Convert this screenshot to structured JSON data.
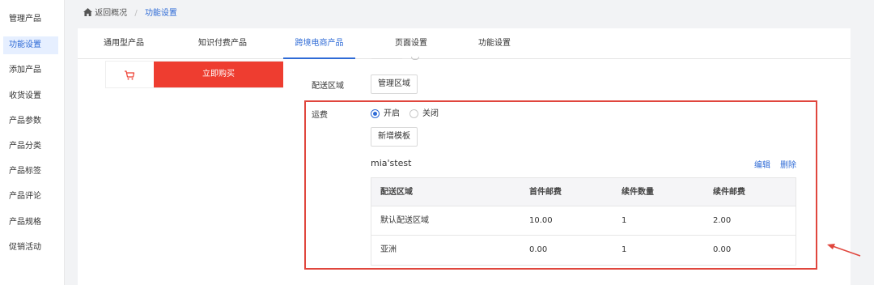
{
  "sidebar": {
    "items": [
      {
        "label": "管理产品"
      },
      {
        "label": "功能设置"
      },
      {
        "label": "添加产品"
      },
      {
        "label": "收货设置"
      },
      {
        "label": "产品参数"
      },
      {
        "label": "产品分类"
      },
      {
        "label": "产品标签"
      },
      {
        "label": "产品评论"
      },
      {
        "label": "产品规格"
      },
      {
        "label": "促销活动"
      }
    ],
    "active_index": 1
  },
  "breadcrumb": {
    "icon": "home-icon",
    "back": "返回概况",
    "separator": "/",
    "current": "功能设置"
  },
  "tabs": [
    {
      "label": "通用型产品"
    },
    {
      "label": "知识付费产品"
    },
    {
      "label": "跨境电商产品"
    },
    {
      "label": "页面设置"
    },
    {
      "label": "功能设置"
    }
  ],
  "active_tab": 2,
  "preview": {
    "cart_icon": "cart-icon",
    "buy_label": "立即购买"
  },
  "delivery": {
    "label": "配送区域",
    "manage_button": "管理区域"
  },
  "shipping": {
    "label": "运费",
    "option_on": "开启",
    "option_off": "关闭",
    "selected": "开启",
    "add_template_button": "新增模板"
  },
  "template": {
    "name": "mia'stest",
    "edit_label": "编辑",
    "delete_label": "删除",
    "columns": [
      "配送区域",
      "首件邮费",
      "续件数量",
      "续件邮费"
    ],
    "rows": [
      [
        "默认配送区域",
        "10.00",
        "1",
        "2.00"
      ],
      [
        "亚洲",
        "0.00",
        "1",
        "0.00"
      ]
    ]
  },
  "colors": {
    "accent": "#2f6bd6",
    "buy_button": "#ee3d30",
    "highlight": "#e0463d"
  }
}
